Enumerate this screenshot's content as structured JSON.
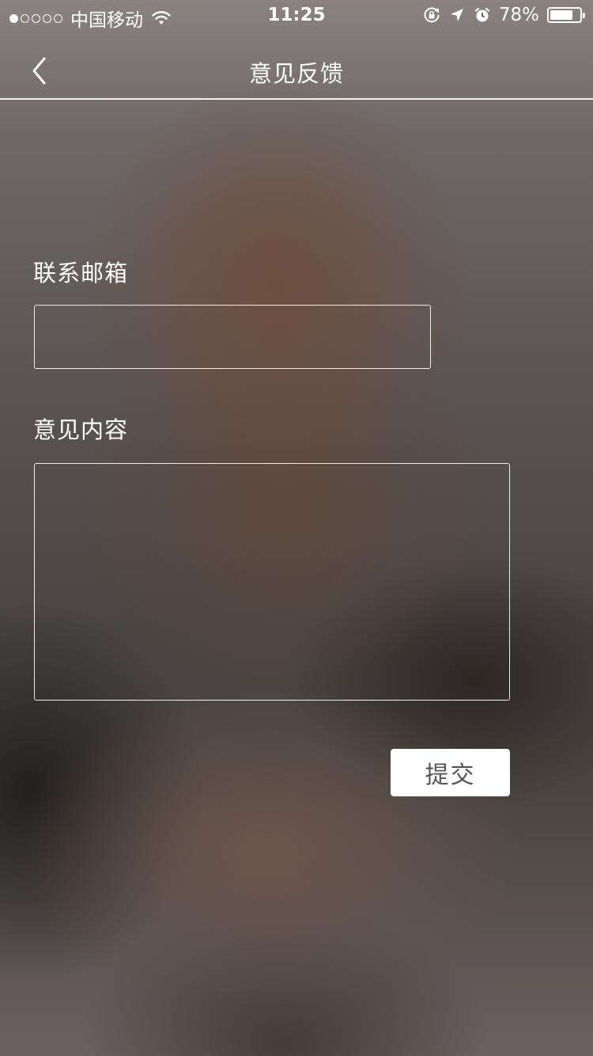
{
  "status_bar": {
    "carrier": "中国移动",
    "time": "11:25",
    "battery_percent": "78%",
    "battery_level": 0.78,
    "signal_bars_filled": 1,
    "signal_bars_total": 5
  },
  "nav": {
    "title": "意见反馈",
    "back_icon": "chevron-left-icon"
  },
  "form": {
    "email_label": "联系邮箱",
    "email_value": "",
    "content_label": "意见内容",
    "content_value": "",
    "submit_label": "提交"
  },
  "colors": {
    "field_border": "#eeeeee",
    "button_bg": "#ffffff",
    "button_text": "#555555"
  }
}
